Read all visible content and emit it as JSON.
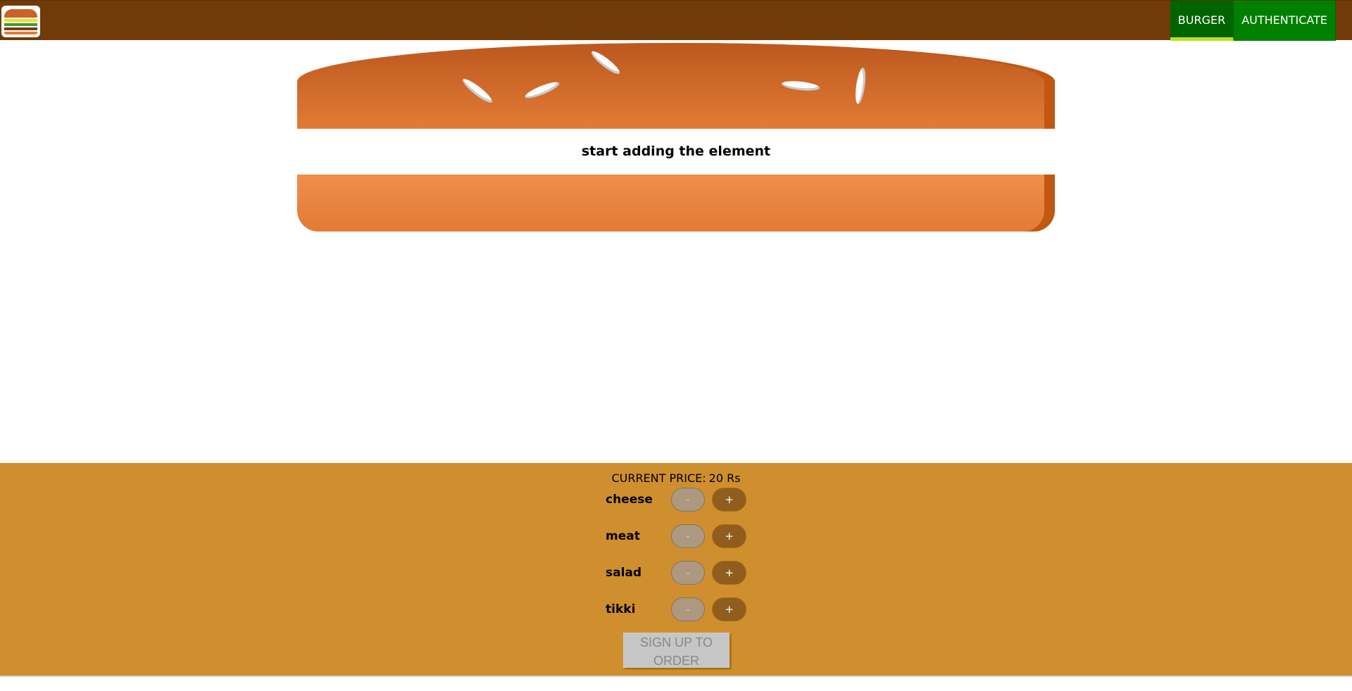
{
  "toolbar": {
    "logo": "burger-logo",
    "nav": [
      {
        "label": "BURGER",
        "active": true
      },
      {
        "label": "AUTHENTICATE",
        "active": false
      }
    ],
    "colors": {
      "bar": "#703b09",
      "nav_active": "#006400",
      "nav": "#008000",
      "active_underline": "#b7e31b"
    }
  },
  "burger": {
    "message": "start adding the element",
    "colors": {
      "bread_top": "#bc581e",
      "bread_bottom": "#e27b36"
    }
  },
  "controls": {
    "price_label": "CURRENT PRICE:",
    "price_value": "20 Rs",
    "less_symbol": "-",
    "more_symbol": "+",
    "ingredients": [
      {
        "label": "cheese"
      },
      {
        "label": "meat"
      },
      {
        "label": "salad"
      },
      {
        "label": "tikki"
      }
    ],
    "order_button": "SIGN UP TO ORDER",
    "colors": {
      "panel": "#cf8f2e",
      "more": "#8f5e1e",
      "less": "#ac9980"
    }
  }
}
